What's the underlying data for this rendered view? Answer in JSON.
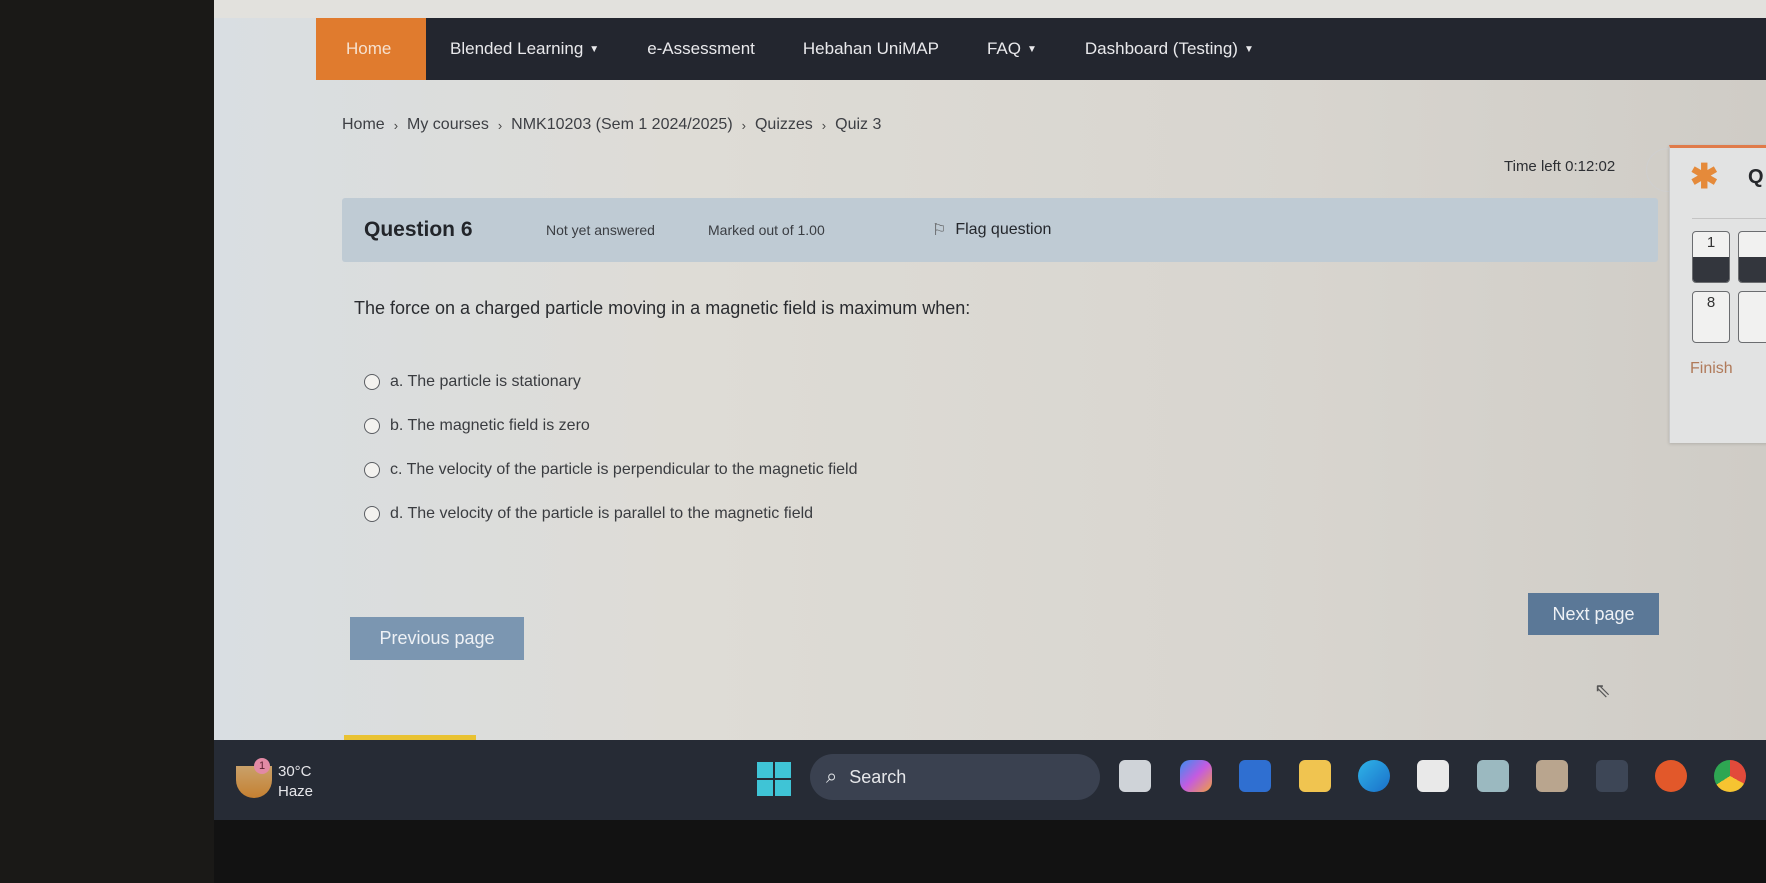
{
  "nav": {
    "items": [
      {
        "label": "Home",
        "dropdown": false,
        "active": true
      },
      {
        "label": "Blended Learning",
        "dropdown": true
      },
      {
        "label": "e-Assessment",
        "dropdown": false
      },
      {
        "label": "Hebahan UniMAP",
        "dropdown": false
      },
      {
        "label": "FAQ",
        "dropdown": true
      },
      {
        "label": "Dashboard (Testing)",
        "dropdown": true
      }
    ],
    "caret": "▼"
  },
  "breadcrumb": {
    "items": [
      "Home",
      "My courses",
      "NMK10203 (Sem 1 2024/2025)",
      "Quizzes",
      "Quiz 3"
    ],
    "separator": "›"
  },
  "timer": {
    "label": "Time left 0:12:02"
  },
  "question": {
    "title": "Question 6",
    "state": "Not yet answered",
    "marks": "Marked out of 1.00",
    "flag_label": "Flag question",
    "text": "The force on a charged particle moving in a magnetic field is maximum when:",
    "answers": [
      {
        "label": "a. The particle is stationary",
        "selected": false
      },
      {
        "label": "b. The magnetic field is zero",
        "selected": false
      },
      {
        "label": "c. The velocity of the particle is perpendicular to the magnetic field",
        "selected": false
      },
      {
        "label": "d. The velocity of the particle is parallel to the magnetic field",
        "selected": false
      }
    ]
  },
  "buttons": {
    "previous": "Previous page",
    "next": "Next page"
  },
  "quiz_nav": {
    "title_initial": "Q",
    "star": "✱",
    "questions": [
      {
        "number": "1",
        "answered": true
      },
      {
        "number": "",
        "answered": true
      },
      {
        "number": "8",
        "answered": false
      },
      {
        "number": "",
        "answered": false
      }
    ],
    "finish_label": "Finish"
  },
  "taskbar": {
    "weather": {
      "temp": "30°C",
      "condition": "Haze",
      "badge": "1"
    },
    "search_label": "Search",
    "apps": [
      "task-view",
      "copilot",
      "word",
      "file-explorer",
      "edge",
      "store",
      "app-1",
      "app-2",
      "app-3",
      "ea",
      "chrome"
    ]
  },
  "colors": {
    "nav_bg": "#23262f",
    "nav_active": "#e07b2e",
    "question_header": "#bfcbd4",
    "button_prev": "#7b96b1",
    "button_next": "#5b7897",
    "quiz_nav_accent": "#e58a3a"
  }
}
